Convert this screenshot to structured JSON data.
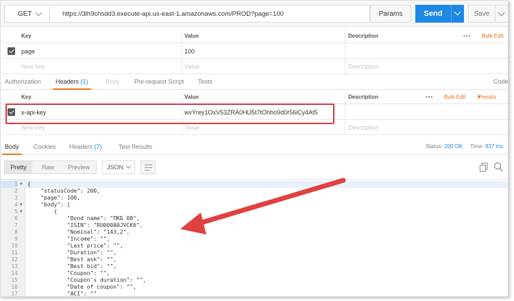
{
  "request": {
    "method": "GET",
    "url": "https://3lh9chsdd3.execute-api.us-east-1.amazonaws.com/PROD?page=100",
    "params_label": "Params",
    "send_label": "Send",
    "save_label": "Save"
  },
  "params_table": {
    "headers": {
      "key": "Key",
      "value": "Value",
      "description": "Description"
    },
    "bulk_edit": "Bulk Edit",
    "row": {
      "key": "page",
      "value": "100"
    },
    "new_row": {
      "key": "New key",
      "value": "Value",
      "description": "Description"
    }
  },
  "request_tabs": {
    "authorization": "Authorization",
    "headers": "Headers",
    "headers_count": "(1)",
    "body": "Body",
    "prerequest": "Pre-request Script",
    "tests": "Tests",
    "code": "Code"
  },
  "headers_table": {
    "headers": {
      "key": "Key",
      "value": "Value",
      "description": "Description"
    },
    "bulk_edit": "Bulk Edit",
    "presets": "Presets",
    "row": {
      "key": "x-api-key",
      "value": "wvYrey1OxV53ZRA0HlJ5t7tOhho9d0r56iCy4At5"
    },
    "new_row": {
      "key": "New key",
      "value": "Value",
      "description": "Description"
    }
  },
  "response_tabs": {
    "body": "Body",
    "cookies": "Cookies",
    "headers": "Headers",
    "headers_count": "(7)",
    "test_results": "Test Results",
    "status_label": "Status:",
    "status_value": "200 OK",
    "time_label": "Time:",
    "time_value": "837 ms"
  },
  "response_toolbar": {
    "pretty": "Pretty",
    "raw": "Raw",
    "preview": "Preview",
    "format": "JSON"
  },
  "code_lines": [
    {
      "n": "1",
      "fold": "▼",
      "text": "{"
    },
    {
      "n": "2",
      "fold": "",
      "text": "    \"statusCode\": 200,"
    },
    {
      "n": "3",
      "fold": "",
      "text": "    \"page\": 100,"
    },
    {
      "n": "4",
      "fold": "▼",
      "text": "    \"body\": ["
    },
    {
      "n": "5",
      "fold": "▼",
      "text": "        {"
    },
    {
      "n": "6",
      "fold": "",
      "text": "            \"Bond name\": \"ПКБ 08\","
    },
    {
      "n": "7",
      "fold": "",
      "text": "            \"ISIN\": \"RU000A0JVCK6\","
    },
    {
      "n": "8",
      "fold": "",
      "text": "            \"Nominal\": \"143,2\","
    },
    {
      "n": "9",
      "fold": "",
      "text": "            \"Income\": \"\","
    },
    {
      "n": "10",
      "fold": "",
      "text": "            \"Last price\": \"\","
    },
    {
      "n": "11",
      "fold": "",
      "text": "            \"Duration\": \"\","
    },
    {
      "n": "12",
      "fold": "",
      "text": "            \"Best ask\": \"\","
    },
    {
      "n": "13",
      "fold": "",
      "text": "            \"Best bid\": \"\","
    },
    {
      "n": "14",
      "fold": "",
      "text": "            \"Coupon\": \"\","
    },
    {
      "n": "15",
      "fold": "",
      "text": "            \"Coupon's duration\": \"\","
    },
    {
      "n": "16",
      "fold": "",
      "text": "            \"Date of coupon\": \"\","
    },
    {
      "n": "17",
      "fold": "",
      "text": "            \"ACI\": \"\""
    }
  ],
  "colors": {
    "accent": "#e8731a",
    "send": "#1e88e5",
    "highlight": "#d9373f",
    "arrow": "#e0403f"
  }
}
